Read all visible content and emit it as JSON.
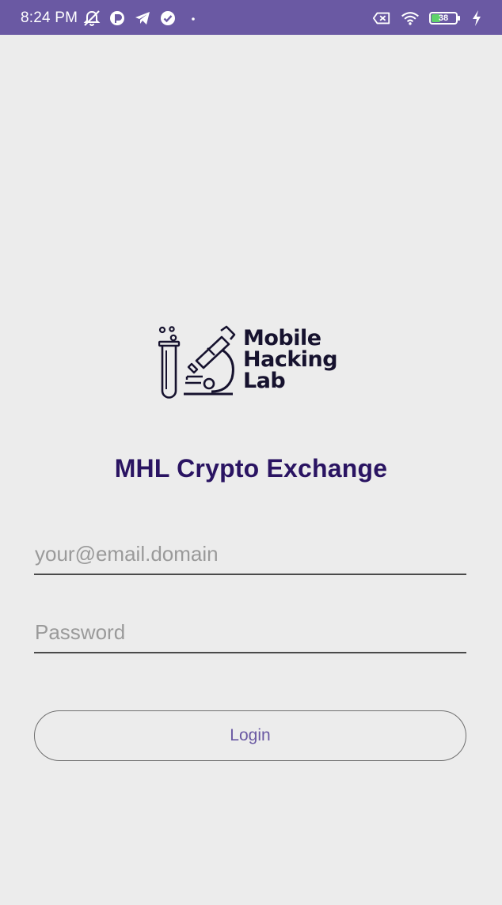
{
  "status_bar": {
    "time": "8:24 PM",
    "battery_level": "38",
    "battery_fraction": 0.38,
    "icons_left": [
      "mute-notification-icon",
      "app-badge-icon",
      "telegram-icon",
      "check-circle-icon",
      "dot-icon"
    ],
    "icons_right": [
      "signal-off-icon",
      "wifi-icon",
      "battery-icon",
      "charging-bolt-icon"
    ]
  },
  "logo": {
    "lines": [
      "Mobile",
      "Hacking",
      "Lab"
    ]
  },
  "app": {
    "title": "MHL Crypto Exchange"
  },
  "form": {
    "email": {
      "value": "",
      "placeholder": "your@email.domain"
    },
    "password": {
      "value": "",
      "placeholder": "Password"
    },
    "login_label": "Login"
  },
  "colors": {
    "status_bar": "#6a59a3",
    "background": "#ececec",
    "title": "#2a1462",
    "button_text": "#6a59a3"
  }
}
